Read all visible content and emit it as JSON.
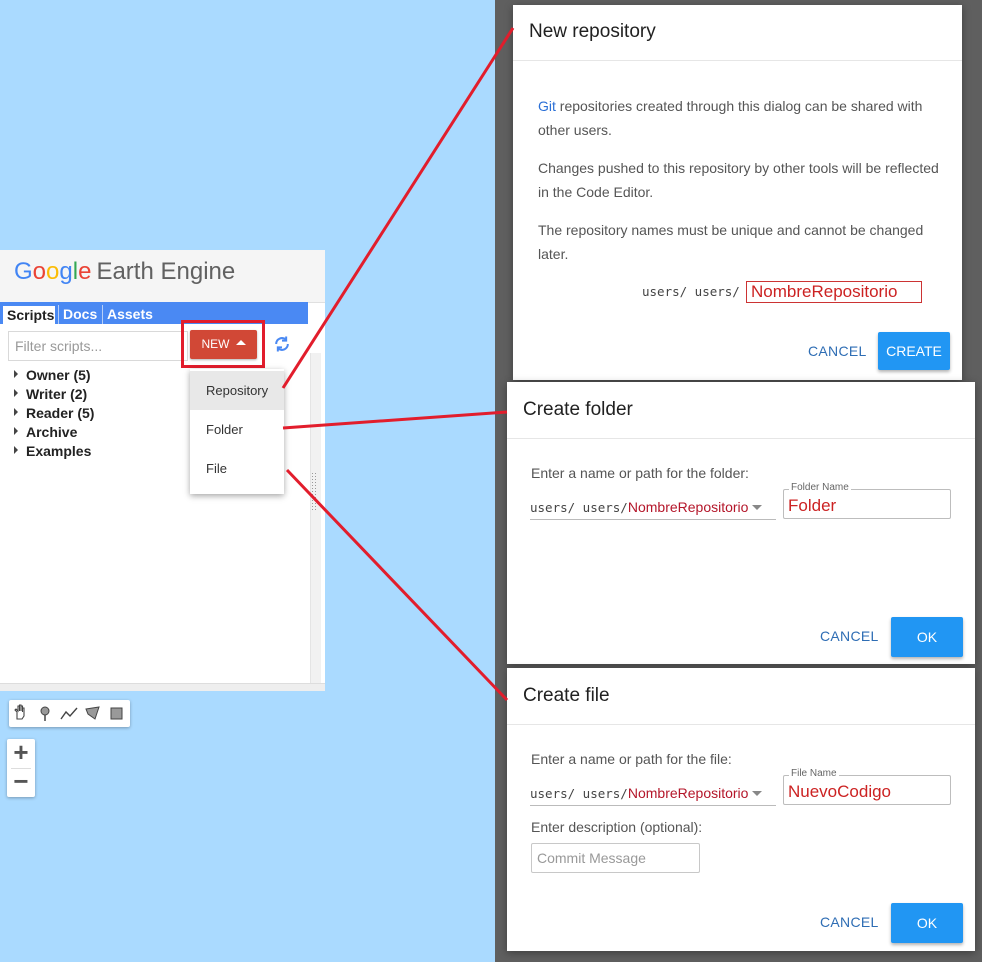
{
  "app": {
    "logo_google": "Google",
    "logo_suffix": "Earth Engine",
    "tabs": [
      "Scripts",
      "Docs",
      "Assets"
    ],
    "filter_placeholder": "Filter scripts...",
    "new_button": "NEW",
    "tree": [
      "Owner (5)",
      "Writer (2)",
      "Reader (5)",
      "Archive",
      "Examples"
    ],
    "new_menu": [
      "Repository",
      "Folder",
      "File"
    ]
  },
  "map_tools": {
    "drawing": [
      "hand-icon",
      "point-icon",
      "line-icon",
      "polygon-icon",
      "rectangle-icon"
    ],
    "zoom_in": "+",
    "zoom_out": "−"
  },
  "new_repository_dialog": {
    "title": "New repository",
    "para1_link": "Git",
    "para1_rest": " repositories created through this dialog can be shared with other users.",
    "para2": "Changes pushed to this repository by other tools will be reflected in the Code Editor.",
    "para3": "The repository names must be unique and cannot be changed later.",
    "path_prefix": "users/ users/",
    "name_value": "NombreRepositorio",
    "cancel": "CANCEL",
    "create": "CREATE"
  },
  "create_folder_dialog": {
    "title": "Create folder",
    "prompt": "Enter a name or path for the folder:",
    "path_prefix": "users/ users/",
    "repo_select": "NombreRepositorio",
    "field_label": "Folder Name",
    "field_value": "Folder",
    "cancel": "CANCEL",
    "ok": "OK"
  },
  "create_file_dialog": {
    "title": "Create file",
    "prompt": "Enter a name or path for the file:",
    "path_prefix": "users/ users/",
    "repo_select": "NombreRepositorio",
    "field_label": "File Name",
    "field_value": "NuevoCodigo",
    "description_label": "Enter description (optional):",
    "description_placeholder": "Commit Message",
    "cancel": "CANCEL",
    "ok": "OK"
  },
  "colors": {
    "map_background": "#aadaff",
    "highlight_red": "#e21d2c",
    "new_button": "#d14836",
    "primary_button": "#2196f3",
    "tab_bar": "#4a89f3"
  }
}
